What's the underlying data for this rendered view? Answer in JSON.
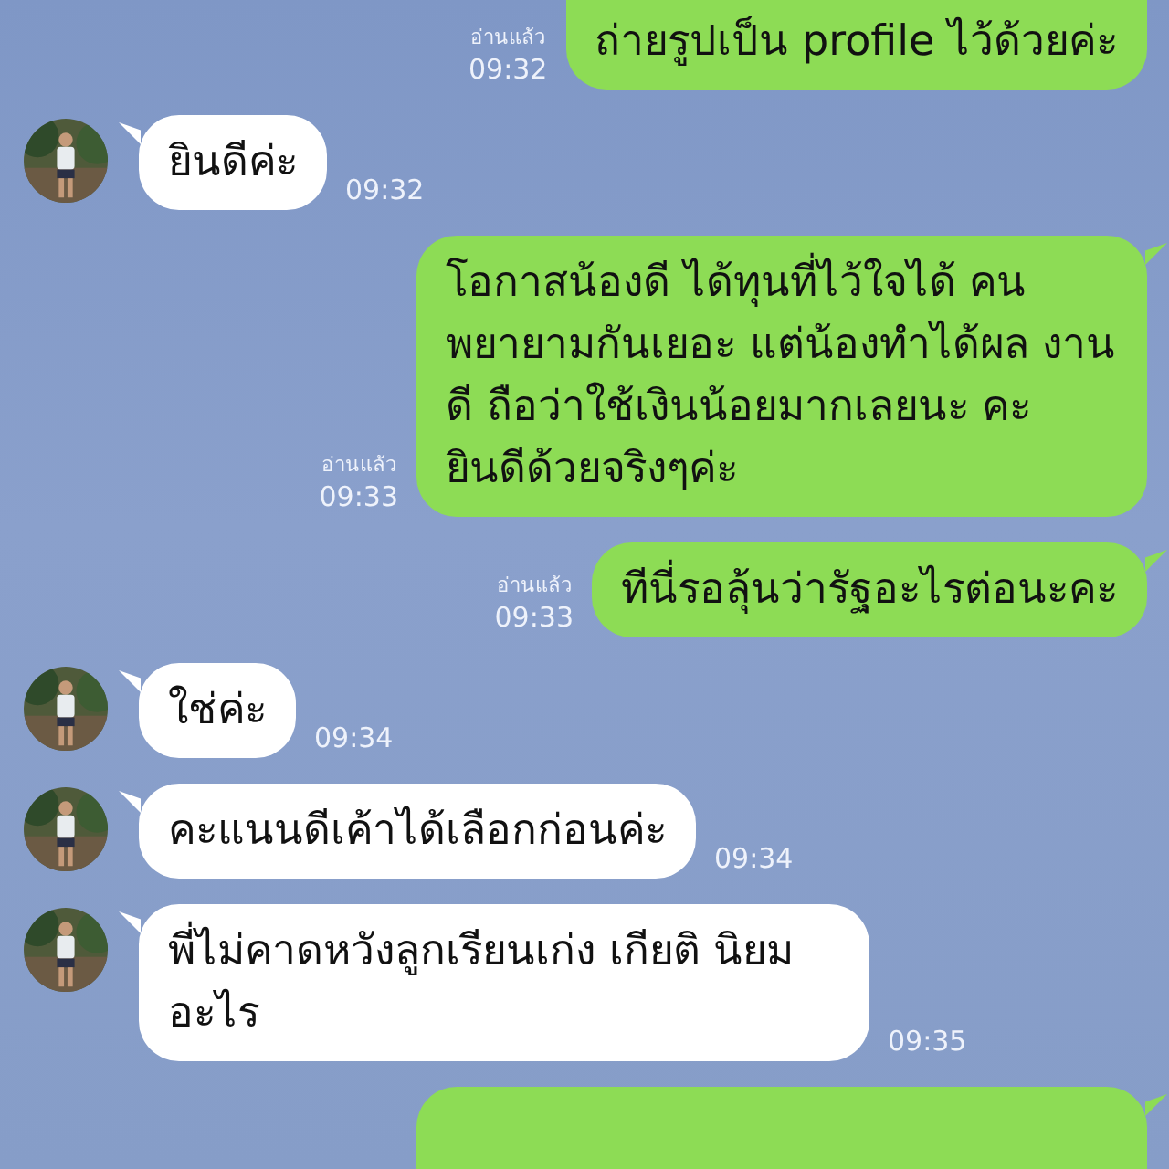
{
  "messages": [
    {
      "kind": "outgoing",
      "cut_top": true,
      "text": "ถ่ายรูปเป็น profile ไว้ด้วยค่ะ",
      "read_label": "อ่านแล้ว",
      "time": "09:32"
    },
    {
      "kind": "incoming",
      "text": "ยินดีค่ะ",
      "time": "09:32"
    },
    {
      "kind": "outgoing",
      "text": "โอกาสน้องดี ได้ทุนที่ไว้ใจได้ คน พยายามกันเยอะ แต่น้องทำได้ผล งานดี ถือว่าใช้เงินน้อยมากเลยนะ คะ ยินดีด้วยจริงๆค่ะ",
      "read_label": "อ่านแล้ว",
      "time": "09:33"
    },
    {
      "kind": "outgoing",
      "text": "ทีนี่รอลุ้นว่ารัฐอะไรต่อนะคะ",
      "read_label": "อ่านแล้ว",
      "time": "09:33"
    },
    {
      "kind": "incoming",
      "text": "ใช่ค่ะ",
      "time": "09:34"
    },
    {
      "kind": "incoming",
      "text": "คะแนนดีเค้าได้เลือกก่อนค่ะ",
      "time": "09:34"
    },
    {
      "kind": "incoming",
      "text": "พี่ไม่คาดหวังลูกเรียนเก่ง เกียติ นิยมอะไร",
      "time": "09:35"
    },
    {
      "kind": "outgoing",
      "cut_bottom": true
    }
  ]
}
